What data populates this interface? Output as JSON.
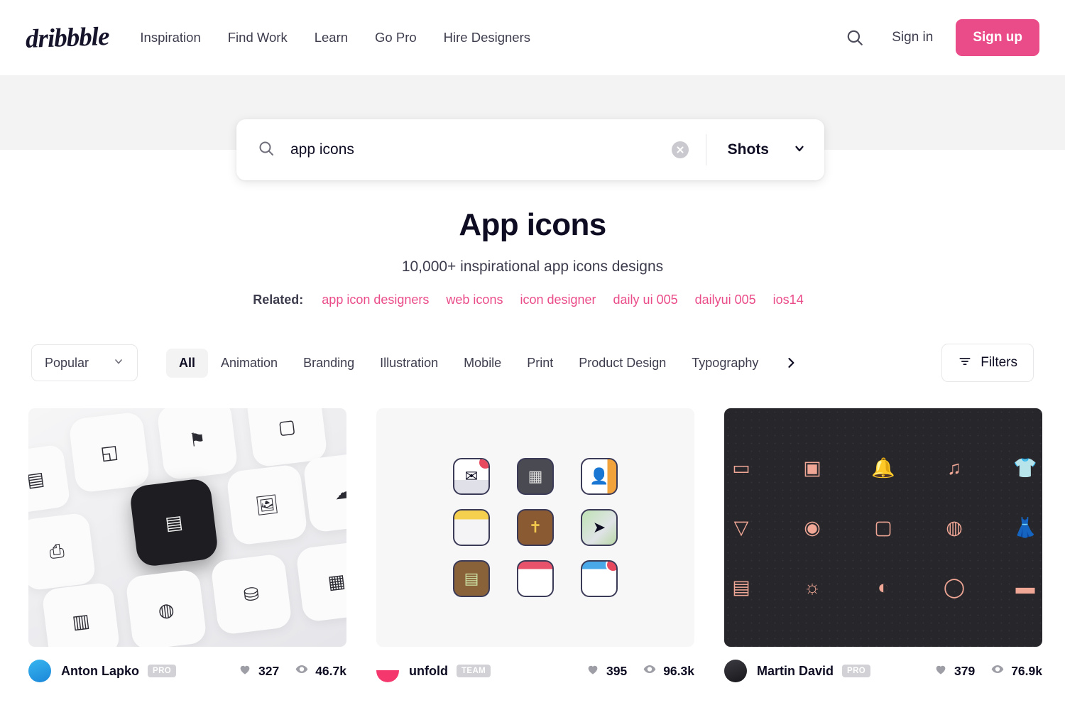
{
  "brand": {
    "logo_text": "dribbble",
    "accent": "#ea4c89",
    "ink": "#0d0c22"
  },
  "header": {
    "nav": [
      {
        "label": "Inspiration"
      },
      {
        "label": "Find Work"
      },
      {
        "label": "Learn"
      },
      {
        "label": "Go Pro"
      },
      {
        "label": "Hire Designers"
      }
    ],
    "search_icon": "search-icon",
    "sign_in_label": "Sign in",
    "sign_up_label": "Sign up"
  },
  "search": {
    "value": "app icons",
    "placeholder": "Search",
    "clear_icon": "close-circle-icon",
    "scope_label": "Shots",
    "scope_caret": "chevron-down-icon"
  },
  "hero": {
    "title": "App icons",
    "subtitle": "10,000+ inspirational app icons designs",
    "related_label": "Related:",
    "related_tags": [
      {
        "label": "app icon designers"
      },
      {
        "label": "web icons"
      },
      {
        "label": "icon designer"
      },
      {
        "label": "daily ui 005"
      },
      {
        "label": "dailyui 005"
      },
      {
        "label": "ios14"
      }
    ]
  },
  "filters": {
    "sort_label": "Popular",
    "sort_caret": "chevron-down-icon",
    "categories": [
      {
        "label": "All",
        "active": true
      },
      {
        "label": "Animation",
        "active": false
      },
      {
        "label": "Branding",
        "active": false
      },
      {
        "label": "Illustration",
        "active": false
      },
      {
        "label": "Mobile",
        "active": false
      },
      {
        "label": "Print",
        "active": false
      },
      {
        "label": "Product Design",
        "active": false
      },
      {
        "label": "Typography",
        "active": false
      }
    ],
    "next_icon": "chevron-right-icon",
    "filters_label": "Filters",
    "filters_icon": "filter-icon"
  },
  "shots": [
    {
      "author": "Anton Lapko",
      "badge": "PRO",
      "likes": "327",
      "views": "46.7k",
      "like_icon": "heart-icon",
      "view_icon": "eye-icon",
      "thumb_style": "light-3d-icon-tiles",
      "thumb_bg": "#ededf0"
    },
    {
      "author": "unfold",
      "badge": "TEAM",
      "likes": "395",
      "views": "96.3k",
      "like_icon": "heart-icon",
      "view_icon": "eye-icon",
      "thumb_style": "flat-ios-icon-grid",
      "thumb_bg": "#f7f7f8"
    },
    {
      "author": "Martin David",
      "badge": "PRO",
      "likes": "379",
      "views": "76.9k",
      "like_icon": "heart-icon",
      "view_icon": "eye-icon",
      "thumb_style": "dark-line-icon-grid",
      "thumb_bg": "#27262b"
    }
  ]
}
